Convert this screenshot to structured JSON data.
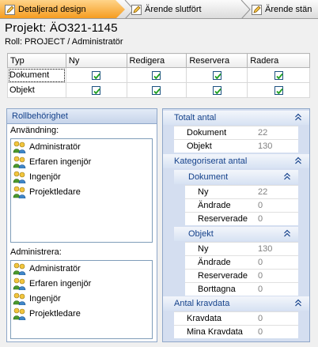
{
  "breadcrumb": {
    "steps": [
      {
        "label": "Detaljerad design",
        "active": true
      },
      {
        "label": "Ärende slutfört",
        "active": false
      },
      {
        "label": "Ärende stän",
        "active": false
      }
    ]
  },
  "header": {
    "title": "Projekt: ÄO321-1145",
    "role_line": "Roll: PROJECT / Administratör"
  },
  "permissions": {
    "columns": [
      "Typ",
      "Ny",
      "Redigera",
      "Reservera",
      "Radera"
    ],
    "rows": [
      {
        "type": "Dokument",
        "checked": [
          true,
          true,
          true,
          true
        ]
      },
      {
        "type": "Objekt",
        "checked": [
          true,
          true,
          true,
          true
        ]
      }
    ]
  },
  "role_panel": {
    "title": "Rollbehörighet",
    "usage_label": "Användning:",
    "usage_items": [
      "Administratör",
      "Erfaren ingenjör",
      "Ingenjör",
      "Projektledare"
    ],
    "admin_label": "Administrera:",
    "admin_items": [
      "Administratör",
      "Erfaren ingenjör",
      "Ingenjör",
      "Projektledare"
    ]
  },
  "stats": {
    "total": {
      "title": "Totalt antal",
      "rows": [
        {
          "label": "Dokument",
          "value": "22"
        },
        {
          "label": "Objekt",
          "value": "130"
        }
      ]
    },
    "categorized": {
      "title": "Kategoriserat antal",
      "document": {
        "title": "Dokument",
        "rows": [
          {
            "label": "Ny",
            "value": "22"
          },
          {
            "label": "Ändrade",
            "value": "0"
          },
          {
            "label": "Reserverade",
            "value": "0"
          }
        ]
      },
      "object": {
        "title": "Objekt",
        "rows": [
          {
            "label": "Ny",
            "value": "130"
          },
          {
            "label": "Ändrade",
            "value": "0"
          },
          {
            "label": "Reserverade",
            "value": "0"
          },
          {
            "label": "Borttagna",
            "value": "0"
          }
        ]
      }
    },
    "requirements": {
      "title": "Antal kravdata",
      "rows": [
        {
          "label": "Kravdata",
          "value": "0"
        },
        {
          "label": "Mina Kravdata",
          "value": "0"
        }
      ]
    }
  },
  "colors": {
    "active_step": "#f59a1c",
    "panel_header_text": "#15428b",
    "panel_border": "#8fa7c9",
    "value_text": "#808080"
  }
}
